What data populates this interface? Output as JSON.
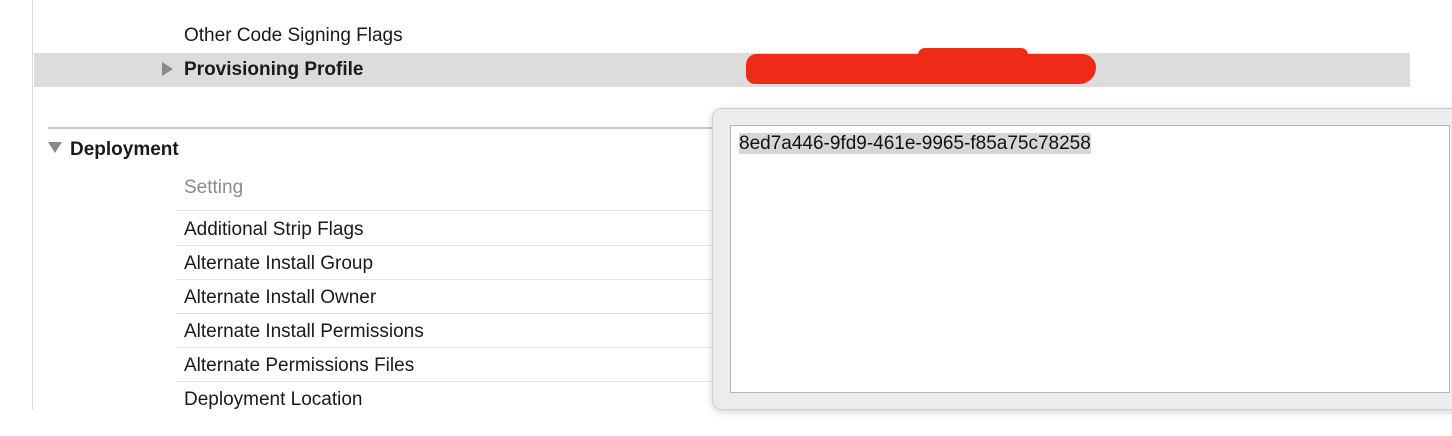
{
  "settings_above": {
    "other_code_signing_flags": "Other Code Signing Flags",
    "provisioning_profile": "Provisioning Profile"
  },
  "deployment": {
    "title": "Deployment",
    "column_header": "Setting",
    "rows": [
      "Additional Strip Flags",
      "Alternate Install Group",
      "Alternate Install Owner",
      "Alternate Install Permissions",
      "Alternate Permissions Files",
      "Deployment Location"
    ]
  },
  "popover": {
    "value": "8ed7a446-9fd9-461e-9965-f85a75c78258"
  },
  "colors": {
    "redaction": "#ef2b17",
    "selected_row": "#dcdcdc"
  }
}
